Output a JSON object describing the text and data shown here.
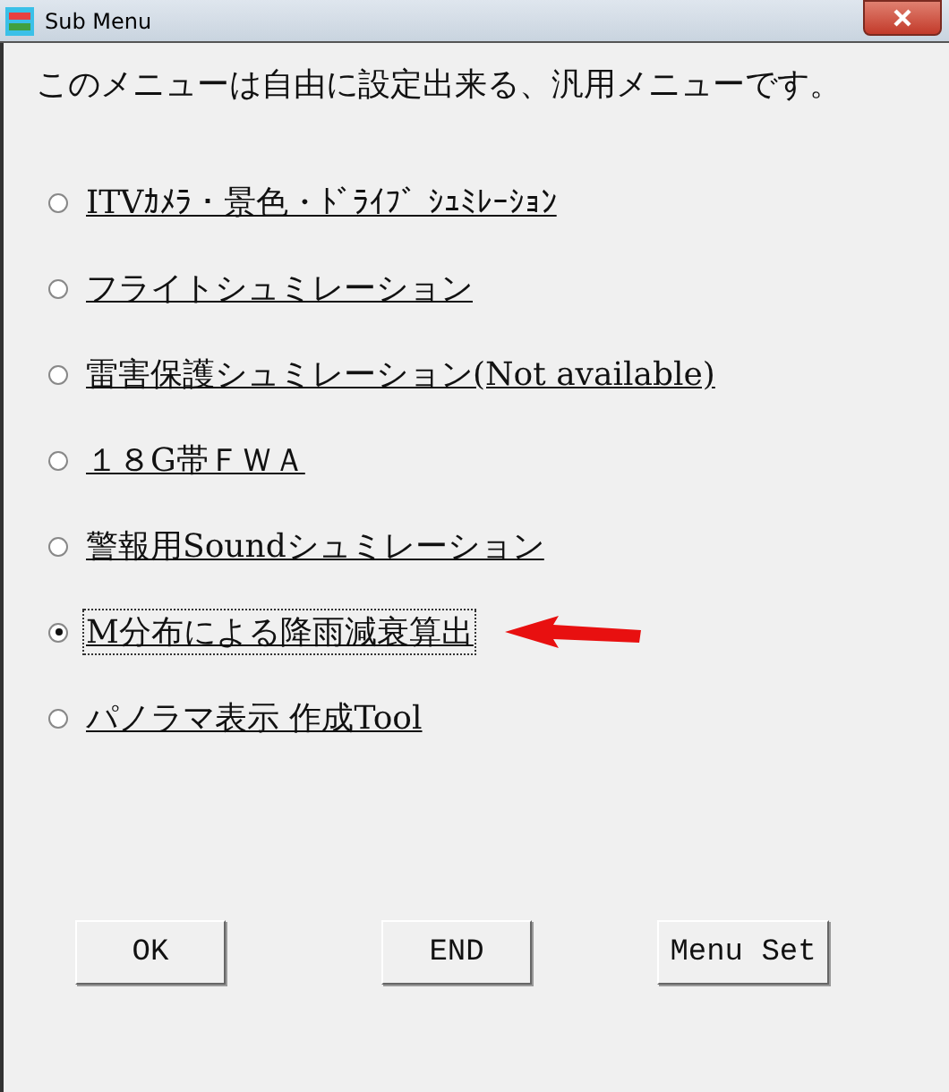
{
  "window": {
    "title": "Sub Menu"
  },
  "description": "このメニューは自由に設定出来る、汎用メニューです。",
  "options": [
    {
      "label": "ITVｶﾒﾗ・景色・ﾄﾞﾗｲﾌﾞ ｼｭﾐﾚｰｼｮﾝ",
      "selected": false
    },
    {
      "label": "フライトシュミレーション",
      "selected": false
    },
    {
      "label": "雷害保護シュミレーション(Not available)",
      "selected": false
    },
    {
      "label": "１８G帯ＦＷＡ",
      "selected": false
    },
    {
      "label": "警報用Soundシュミレーション",
      "selected": false
    },
    {
      "label": "M分布による降雨減衰算出",
      "selected": true
    },
    {
      "label": "パノラマ表示 作成Tool",
      "selected": false
    }
  ],
  "buttons": [
    "OK",
    "END",
    "Menu Set"
  ]
}
